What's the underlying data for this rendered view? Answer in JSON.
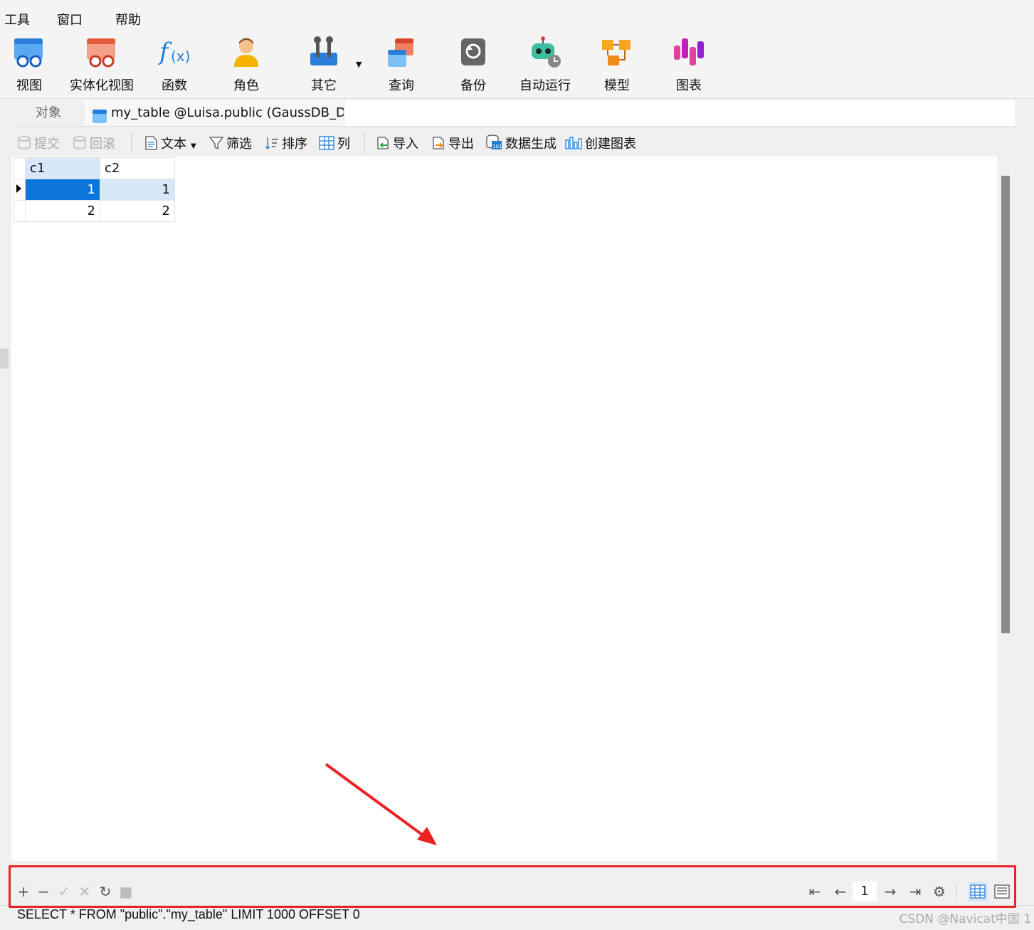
{
  "menu": [
    "工具",
    "窗口",
    "帮助"
  ],
  "ribbon": [
    {
      "label": "视图",
      "icon": "view-icon"
    },
    {
      "label": "实体化视图",
      "icon": "materialized-view-icon"
    },
    {
      "label": "函数",
      "icon": "function-icon"
    },
    {
      "label": "角色",
      "icon": "role-icon"
    },
    {
      "label": "其它",
      "icon": "other-icon"
    },
    {
      "label": "查询",
      "icon": "query-icon"
    },
    {
      "label": "备份",
      "icon": "backup-icon"
    },
    {
      "label": "自动运行",
      "icon": "automation-icon"
    },
    {
      "label": "模型",
      "icon": "model-icon"
    },
    {
      "label": "图表",
      "icon": "chart-icon"
    }
  ],
  "tabs": {
    "objects": "对象",
    "active": "my_table @Luisa.public (GaussDB_D..."
  },
  "toolbar": {
    "commit": "提交",
    "rollback": "回滚",
    "text": "文本",
    "filter": "筛选",
    "sort": "排序",
    "columns": "列",
    "import": "导入",
    "export": "导出",
    "data_gen": "数据生成",
    "create_chart": "创建图表"
  },
  "grid": {
    "columns": [
      "c1",
      "c2"
    ],
    "rows": [
      [
        "1",
        "1"
      ],
      [
        "2",
        "2"
      ]
    ]
  },
  "pager": {
    "page": "1"
  },
  "status": {
    "sql": "SELECT * FROM \"public\".\"my_table\" LIMIT 1000 OFFSET 0",
    "watermark": "CSDN @Navicat中国 1"
  },
  "colors": {
    "selected": "#0a74d8",
    "highlight": "#d6e8f8",
    "annotation": "#ee2222"
  }
}
